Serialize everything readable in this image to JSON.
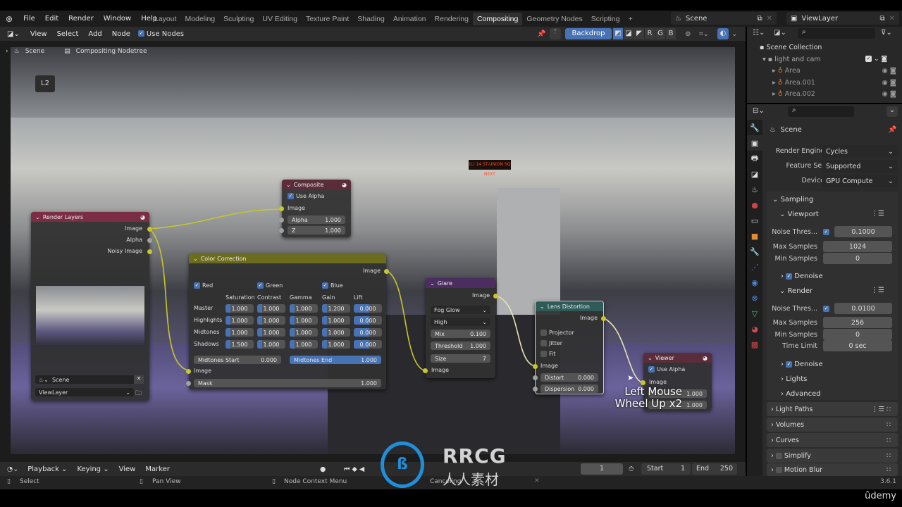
{
  "topbar": {
    "menus": [
      "File",
      "Edit",
      "Render",
      "Window",
      "Help"
    ],
    "workspaces": [
      "Layout",
      "Modeling",
      "Sculpting",
      "UV Editing",
      "Texture Paint",
      "Shading",
      "Animation",
      "Rendering",
      "Compositing",
      "Geometry Nodes",
      "Scripting"
    ],
    "active_workspace": "Compositing",
    "scene": "Scene",
    "view_layer": "ViewLayer"
  },
  "header": {
    "menus": [
      "View",
      "Select",
      "Add",
      "Node"
    ],
    "use_nodes": "Use Nodes",
    "backdrop": "Backdrop",
    "channels": [
      "R",
      "G",
      "B"
    ]
  },
  "breadcrumb": {
    "scene": "Scene",
    "tree": "Compositing Nodetree"
  },
  "nodes": {
    "render_layers": {
      "title": "Render Layers",
      "outputs": [
        "Image",
        "Alpha",
        "Noisy Image"
      ],
      "scene": "Scene",
      "view_layer": "ViewLayer"
    },
    "composite": {
      "title": "Composite",
      "use_alpha": "Use Alpha",
      "image": "Image",
      "alpha_label": "Alpha",
      "alpha": "1.000",
      "z_label": "Z",
      "z": "1.000"
    },
    "color_correction": {
      "title": "Color Correction",
      "output": "Image",
      "channels": [
        "Red",
        "Green",
        "Blue"
      ],
      "columns": [
        "Saturation",
        "Contrast",
        "Gamma",
        "Gain",
        "Lift"
      ],
      "rows": [
        {
          "label": "Master",
          "values": [
            "1.000",
            "1.000",
            "1.000",
            "1.200",
            "0.000"
          ]
        },
        {
          "label": "Highlights",
          "values": [
            "1.000",
            "1.000",
            "1.000",
            "1.000",
            "0.000"
          ]
        },
        {
          "label": "Midtones",
          "values": [
            "1.000",
            "1.000",
            "1.000",
            "1.000",
            "0.000"
          ]
        },
        {
          "label": "Shadows",
          "values": [
            "1.500",
            "1.000",
            "1.000",
            "1.000",
            "0.000"
          ]
        }
      ],
      "midtones_start_label": "Midtones Start",
      "midtones_start": "0.000",
      "midtones_end_label": "Midtones End",
      "midtones_end": "1.000",
      "input": "Image",
      "mask_label": "Mask",
      "mask": "1.000"
    },
    "glare": {
      "title": "Glare",
      "output": "Image",
      "type": "Fog Glow",
      "quality": "High",
      "mix_label": "Mix",
      "mix": "0.100",
      "threshold_label": "Threshold",
      "threshold": "1.000",
      "size_label": "Size",
      "size": "7",
      "input": "Image"
    },
    "lens_distortion": {
      "title": "Lens Distortion",
      "output": "Image",
      "projector": "Projector",
      "jitter": "Jitter",
      "fit": "Fit",
      "input": "Image",
      "distort_label": "Distort",
      "distort": "0.000",
      "dispersion_label": "Dispersion",
      "dispersion": "0.000"
    },
    "viewer": {
      "title": "Viewer",
      "use_alpha": "Use Alpha",
      "image": "Image",
      "alpha": "1.000",
      "z": "1.000"
    }
  },
  "overlay": {
    "line1": "Left Mouse",
    "line2": "Wheel Up x2"
  },
  "outliner": {
    "root": "Scene Collection",
    "collection": "light and cam",
    "items": [
      "Area",
      "Area.001",
      "Area.002"
    ]
  },
  "properties": {
    "context": "Scene",
    "render_engine_label": "Render Engine",
    "render_engine": "Cycles",
    "feature_set_label": "Feature Set",
    "feature_set": "Supported",
    "device_label": "Device",
    "device": "GPU Compute",
    "sampling": "Sampling",
    "viewport": "Viewport",
    "render": "Render",
    "viewport_noise_label": "Noise Thres...",
    "viewport_noise": "0.1000",
    "viewport_max_label": "Max Samples",
    "viewport_max": "1024",
    "viewport_min_label": "Min Samples",
    "viewport_min": "0",
    "denoise": "Denoise",
    "render_noise_label": "Noise Thres...",
    "render_noise": "0.0100",
    "render_max_label": "Max Samples",
    "render_max": "256",
    "render_min_label": "Min Samples",
    "render_min": "0",
    "time_limit_label": "Time Limit",
    "time_limit": "0 sec",
    "lights": "Lights",
    "advanced": "Advanced",
    "panels": [
      "Light Paths",
      "Volumes",
      "Curves",
      "Simplify",
      "Motion Blur"
    ]
  },
  "timeline": {
    "menus": [
      "Playback",
      "Keying",
      "View",
      "Marker"
    ],
    "current_frame": "1",
    "start_label": "Start",
    "start": "1",
    "end_label": "End",
    "end": "250"
  },
  "status": {
    "select": "Select",
    "pan": "Pan View",
    "context": "Node Context Menu",
    "cancel": "Canceling",
    "version": "3.6.1"
  },
  "watermark": {
    "brand": "RRCG",
    "subtitle": "人人素材",
    "udemy": "ûdemy"
  },
  "colors": {
    "accent": "#4772b3",
    "socket_color": "#c7c729",
    "render_layers_header": "#7a2d44",
    "composite_header": "#5b2d3b",
    "color_header": "#6c6c1f",
    "glare_header": "#4b2d60",
    "distort_header": "#2e5a58"
  }
}
